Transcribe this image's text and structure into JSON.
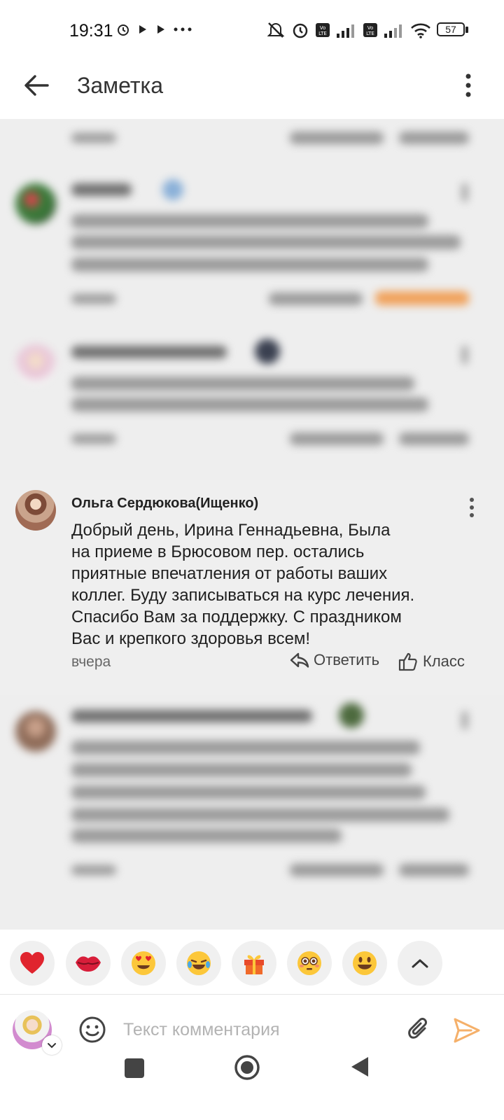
{
  "status_bar": {
    "time": "19:31",
    "battery": "57",
    "icons": [
      "alarm-icon",
      "play-icon",
      "play-icon",
      "more-dots-icon",
      "mute-icon",
      "alarm-icon",
      "volte-icon",
      "signal-icon",
      "volte-icon",
      "signal-icon",
      "wifi-icon",
      "battery-icon"
    ]
  },
  "header": {
    "title": "Заметка",
    "back_icon": "arrow-left-icon",
    "menu_icon": "more-vertical-icon"
  },
  "comment": {
    "author": "Ольга Сердюкова(Ищенко)",
    "text_lines": [
      "Добрый день, Ирина Геннадьевна, Была",
      "на приеме в Брюсовом пер. остались",
      "приятные впечатления от работы ваших",
      "коллег. Буду записываться на курс лечения.",
      "Спасибо Вам за поддержку. С праздником",
      "Вас и крепкого здоровья всем!"
    ],
    "date": "вчера",
    "reply_label": "Ответить",
    "like_label": "Класс"
  },
  "reactions": [
    "❤️",
    "💋",
    "😍",
    "😂",
    "🎁",
    "😳",
    "😃"
  ],
  "input": {
    "placeholder": "Текст комментария"
  },
  "colors": {
    "accent": "#f59a3c",
    "feed_bg": "#eeeeee",
    "text": "#1f1f1f"
  }
}
